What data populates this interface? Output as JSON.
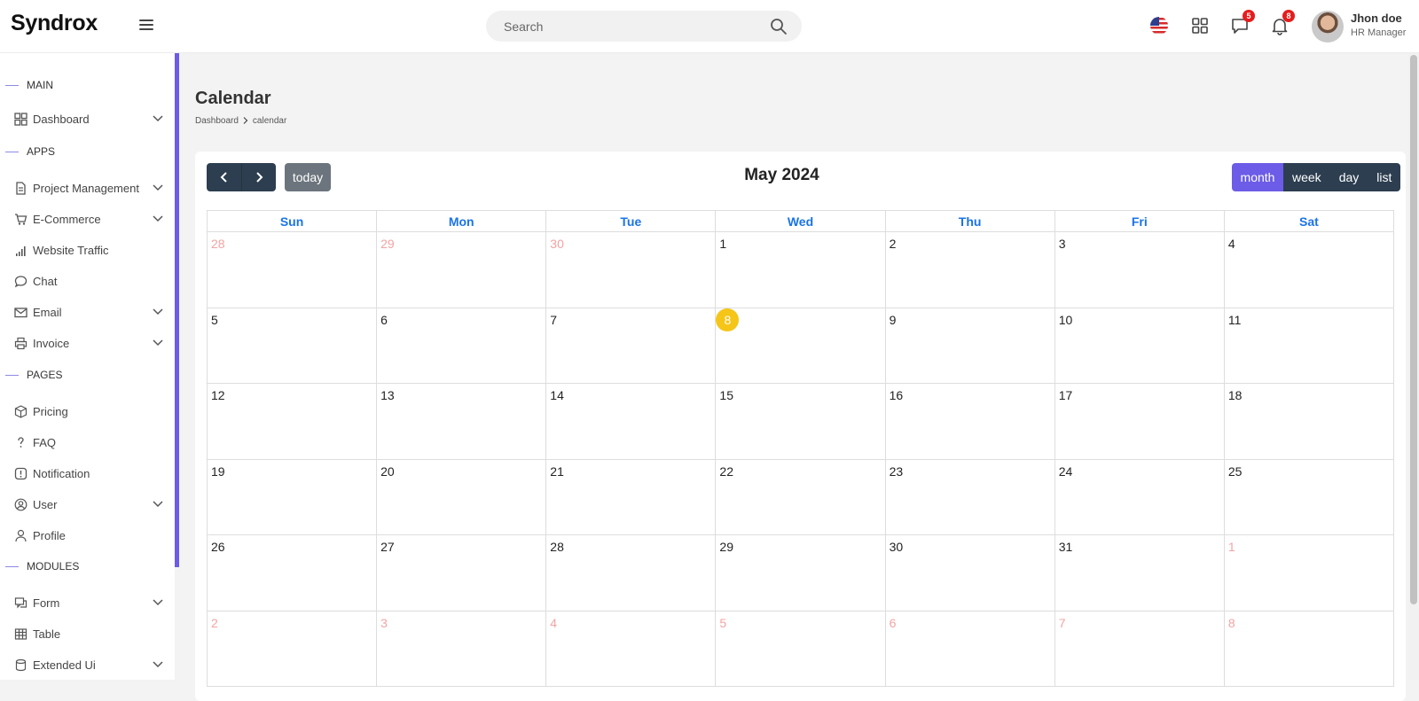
{
  "header": {
    "brand": "Syndrox",
    "search_placeholder": "Search",
    "chat_badge": "5",
    "notif_badge": "8",
    "user_name": "Jhon doe",
    "user_role": "HR Manager"
  },
  "sidebar": {
    "sections": {
      "main": "MAIN",
      "apps": "APPS",
      "pages": "PAGES",
      "modules": "MODULES"
    },
    "items": [
      {
        "label": "Dashboard",
        "icon": "grid-icon",
        "chevron": true
      },
      {
        "label": "Project Management",
        "icon": "document-icon",
        "chevron": true
      },
      {
        "label": "E-Commerce",
        "icon": "cart-icon",
        "chevron": true
      },
      {
        "label": "Website Traffic",
        "icon": "signal-icon",
        "chevron": false
      },
      {
        "label": "Chat",
        "icon": "chat-icon",
        "chevron": false
      },
      {
        "label": "Email",
        "icon": "mail-icon",
        "chevron": true
      },
      {
        "label": "Invoice",
        "icon": "printer-icon",
        "chevron": true
      },
      {
        "label": "Pricing",
        "icon": "box-icon",
        "chevron": false
      },
      {
        "label": "FAQ",
        "icon": "question-icon",
        "chevron": false
      },
      {
        "label": "Notification",
        "icon": "alert-icon",
        "chevron": false
      },
      {
        "label": "User",
        "icon": "user-circle-icon",
        "chevron": true
      },
      {
        "label": "Profile",
        "icon": "user-icon",
        "chevron": false
      },
      {
        "label": "Form",
        "icon": "form-icon",
        "chevron": true
      },
      {
        "label": "Table",
        "icon": "table-icon",
        "chevron": false
      },
      {
        "label": "Extended Ui",
        "icon": "database-icon",
        "chevron": true
      }
    ]
  },
  "page": {
    "title": "Calendar",
    "breadcrumb_root": "Dashboard",
    "breadcrumb_current": "calendar"
  },
  "calendar": {
    "title": "May 2024",
    "today_label": "today",
    "views": [
      "month",
      "week",
      "day",
      "list"
    ],
    "active_view": "month",
    "weekdays": [
      "Sun",
      "Mon",
      "Tue",
      "Wed",
      "Thu",
      "Fri",
      "Sat"
    ],
    "weeks": [
      [
        {
          "d": "28",
          "o": true
        },
        {
          "d": "29",
          "o": true
        },
        {
          "d": "30",
          "o": true
        },
        {
          "d": "1"
        },
        {
          "d": "2"
        },
        {
          "d": "3"
        },
        {
          "d": "4"
        }
      ],
      [
        {
          "d": "5"
        },
        {
          "d": "6"
        },
        {
          "d": "7"
        },
        {
          "d": "8",
          "today": true
        },
        {
          "d": "9"
        },
        {
          "d": "10"
        },
        {
          "d": "11"
        }
      ],
      [
        {
          "d": "12"
        },
        {
          "d": "13"
        },
        {
          "d": "14"
        },
        {
          "d": "15"
        },
        {
          "d": "16"
        },
        {
          "d": "17"
        },
        {
          "d": "18"
        }
      ],
      [
        {
          "d": "19"
        },
        {
          "d": "20"
        },
        {
          "d": "21"
        },
        {
          "d": "22"
        },
        {
          "d": "23"
        },
        {
          "d": "24"
        },
        {
          "d": "25"
        }
      ],
      [
        {
          "d": "26"
        },
        {
          "d": "27"
        },
        {
          "d": "28"
        },
        {
          "d": "29"
        },
        {
          "d": "30"
        },
        {
          "d": "31"
        },
        {
          "d": "1",
          "o": true
        }
      ],
      [
        {
          "d": "2",
          "o": true
        },
        {
          "d": "3",
          "o": true
        },
        {
          "d": "4",
          "o": true
        },
        {
          "d": "5",
          "o": true
        },
        {
          "d": "6",
          "o": true
        },
        {
          "d": "7",
          "o": true
        },
        {
          "d": "8",
          "o": true
        }
      ]
    ]
  },
  "colors": {
    "accent": "#6c5ce7",
    "button_dark": "#2c3e50",
    "weekday_header": "#1a73e8",
    "today_highlight": "#f5c518",
    "other_month_day": "#f4a3a3",
    "badge": "#e51d1d"
  }
}
